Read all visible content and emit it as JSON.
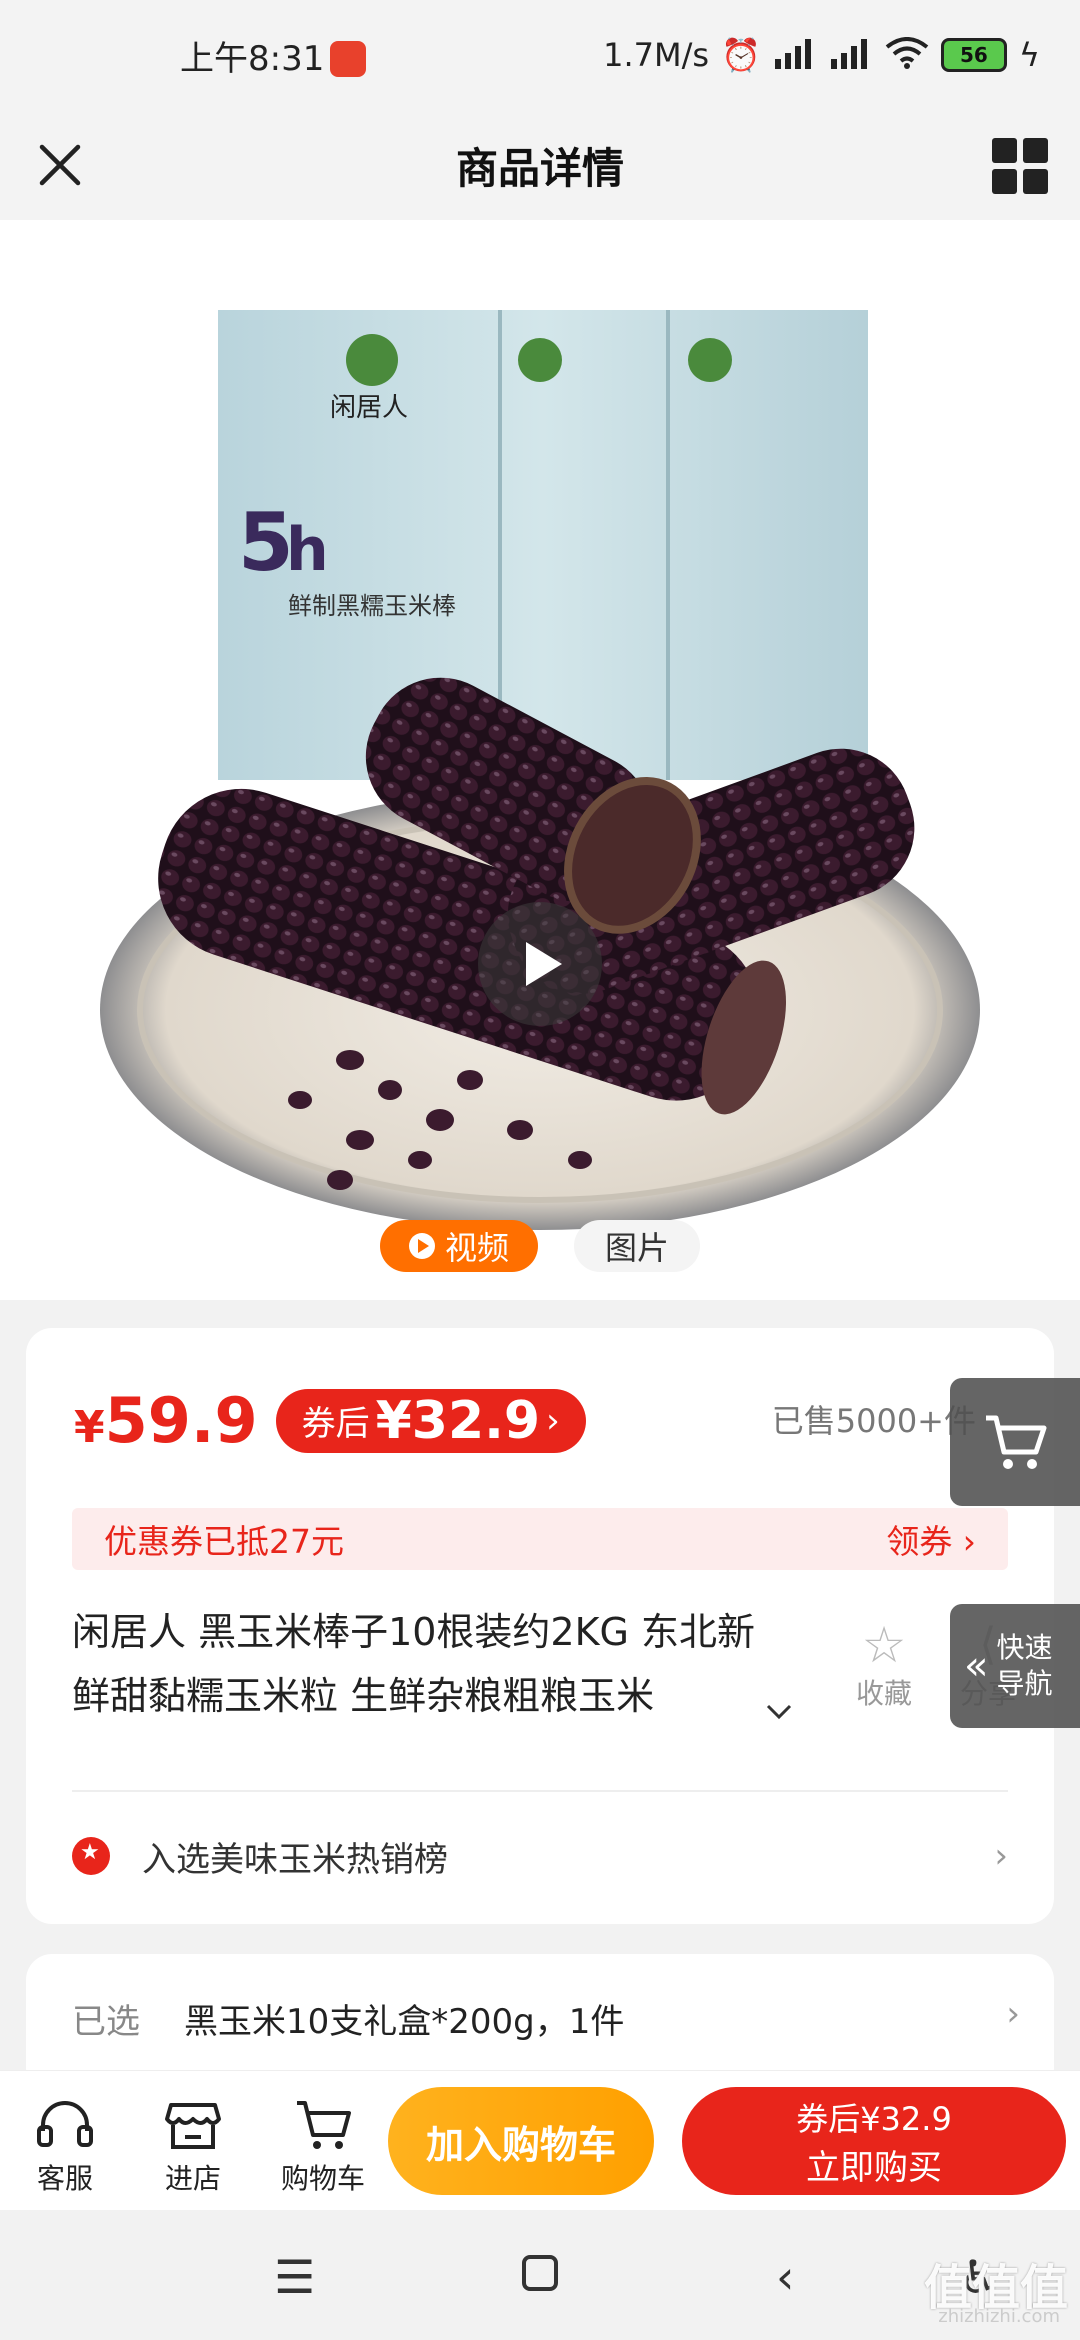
{
  "status_bar": {
    "time": "上午8:31",
    "speed": "1.7M/s",
    "battery": "56"
  },
  "header": {
    "title": "商品详情"
  },
  "hero": {
    "tabs": [
      "视频",
      "图片"
    ],
    "package_brand": "闲居人",
    "package_title": "鲜制黑糯玉米棒"
  },
  "price": {
    "currency": "¥",
    "value": "59.9",
    "coupon_label": "券后",
    "coupon_price": "¥32.9",
    "coupon_arrow": "›",
    "sold": "已售5000+件"
  },
  "coupon_bar": {
    "text": "优惠券已抵27元",
    "action": "领券 ›"
  },
  "product": {
    "title": "闲居人 黑玉米棒子10根装约2KG 东北新鲜甜黏糯玉米粒 生鲜杂粮粗粮玉米",
    "fav_label": "收藏",
    "share_label": "分享"
  },
  "rank": {
    "text": "入选美味玉米热销榜"
  },
  "selection": {
    "label": "已选",
    "value": "黑玉米10支礼盒*200g，1件"
  },
  "float": {
    "nav_label_1": "快速",
    "nav_label_2": "导航"
  },
  "action_bar": {
    "service": "客服",
    "store": "进店",
    "cart": "购物车",
    "add_cart": "加入购物车",
    "buy_line1": "券后¥32.9",
    "buy_line2": "立即购买"
  },
  "watermark": {
    "main": "值值值",
    "sub": "zhizhizhi.com"
  },
  "colors": {
    "accent_red": "#e8251b",
    "accent_orange": "#ff6f00",
    "cart_yellow": "#ffa000"
  }
}
